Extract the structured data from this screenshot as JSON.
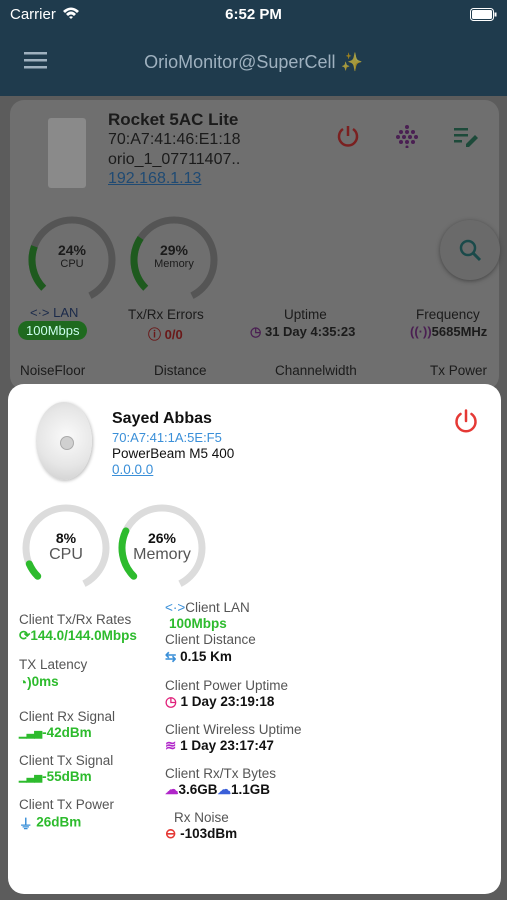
{
  "status": {
    "carrier": "Carrier",
    "time": "6:52 PM"
  },
  "nav": {
    "title": "OrioMonitor@SuperCell",
    "sparkle": "✨"
  },
  "device": {
    "name": "Rocket 5AC Lite",
    "mac": "70:A7:41:46:E1:18",
    "ssid": "orio_1_07711407..",
    "ip": "192.168.1.13",
    "cpu": {
      "value": "24%",
      "label": "CPU",
      "fraction": 0.24
    },
    "memory": {
      "value": "29%",
      "label": "Memory",
      "fraction": 0.29
    },
    "lan": {
      "label": "LAN",
      "value": "100Mbps"
    },
    "txrx_errors": {
      "label": "Tx/Rx Errors",
      "value": "0/0"
    },
    "uptime": {
      "label": "Uptime",
      "value": "31 Day 4:35:23"
    },
    "frequency": {
      "label": "Frequency",
      "value": "5685MHz"
    },
    "noisefloor": {
      "label": "NoiseFloor"
    },
    "distance": {
      "label": "Distance"
    },
    "channelwidth": {
      "label": "Channelwidth"
    },
    "txpower": {
      "label": "Tx Power"
    }
  },
  "client": {
    "name": "Sayed Abbas",
    "mac": "70:A7:41:1A:5E:F5",
    "model": "PowerBeam M5 400",
    "ip": "0.0.0.0",
    "cpu": {
      "value": "8%",
      "label": "CPU",
      "fraction": 0.08
    },
    "memory": {
      "value": "26%",
      "label": "Memory",
      "fraction": 0.26
    },
    "left": [
      {
        "label": "Client Tx/Rx Rates",
        "value": "144.0/144.0Mbps",
        "icon": "sync-icon"
      },
      {
        "label": "TX Latency",
        "value": "0ms",
        "icon": "latency-icon"
      },
      {
        "label": "Client Rx Signal",
        "value": "-42dBm",
        "icon": "signal-icon"
      },
      {
        "label": "Client Tx Signal",
        "value": "-55dBm",
        "icon": "signal-icon"
      },
      {
        "label": "Client Tx Power",
        "value": "26dBm",
        "icon": "plug-icon"
      }
    ],
    "right": {
      "lan": {
        "label": "Client LAN",
        "value": "100Mbps"
      },
      "distance": {
        "label": "Client Distance",
        "value": "0.15 Km"
      },
      "power_uptime": {
        "label": "Client Power Uptime",
        "value": "1 Day 23:19:18"
      },
      "wireless_uptime": {
        "label": "Client Wireless Uptime",
        "value": "1 Day 23:17:47"
      },
      "bytes": {
        "label": "Client Rx/Tx Bytes",
        "rx": "3.6GB",
        "tx": "1.1GB"
      },
      "noise": {
        "label": "Rx Noise",
        "value": "-103dBm"
      }
    }
  },
  "colors": {
    "accent_green": "#2dbb2d",
    "power_red": "#e53935",
    "link_blue": "#3a8fd8",
    "purple": "#b026c9"
  }
}
